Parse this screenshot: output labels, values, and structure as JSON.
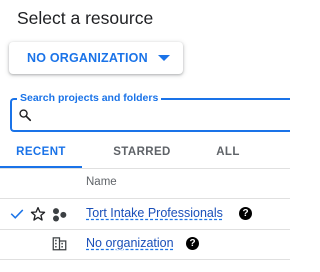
{
  "dialog": {
    "title": "Select a resource"
  },
  "org_selector": {
    "label": "NO ORGANIZATION",
    "icon": "caret-down-icon"
  },
  "search": {
    "legend": "Search projects and folders",
    "value": "",
    "icon": "search-icon"
  },
  "tabs": [
    {
      "label": "RECENT",
      "active": true
    },
    {
      "label": "STARRED",
      "active": false
    },
    {
      "label": "ALL",
      "active": false
    }
  ],
  "table": {
    "columns": [
      "Name"
    ],
    "rows": [
      {
        "selected": true,
        "starred": false,
        "type_icon": "project-icon",
        "name": "Tort Intake Professionals",
        "help": "?"
      },
      {
        "selected": false,
        "starred": false,
        "type_icon": "organization-icon",
        "name": "No organization",
        "help": "?"
      }
    ]
  },
  "colors": {
    "accent": "#1a73e8",
    "text": "#202124",
    "muted": "#5f6368",
    "divider": "#e0e0e0"
  }
}
